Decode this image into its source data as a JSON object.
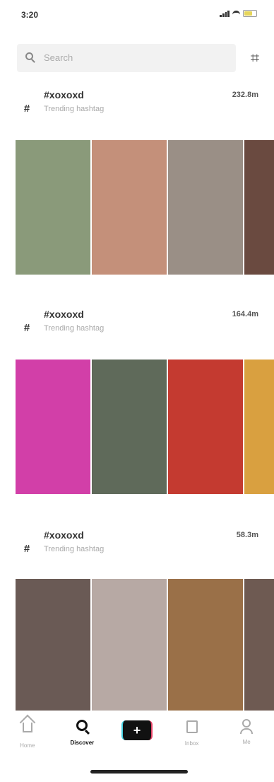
{
  "status": {
    "time": "3:20"
  },
  "search": {
    "placeholder": "Search",
    "scan_glyph": "⌗"
  },
  "sections": [
    {
      "title": "#xoxoxd",
      "subtitle": "Trending hashtag",
      "count": "232.8m",
      "thumb_colors": [
        "#8a9a7a",
        "#c4907a",
        "#9a8f86",
        "#6a4a40"
      ]
    },
    {
      "title": "#xoxoxd",
      "subtitle": "Trending hashtag",
      "count": "164.4m",
      "thumb_colors": [
        "#d23fa8",
        "#5f6a5a",
        "#c43a30",
        "#d9a040"
      ]
    },
    {
      "title": "#xoxoxd",
      "subtitle": "Trending hashtag",
      "count": "58.3m",
      "thumb_colors": [
        "#6a5a55",
        "#b7a9a4",
        "#9a7048",
        "#6e5a52"
      ]
    }
  ],
  "tabbar": {
    "home_label": "Home",
    "discover_label": "Discover",
    "create_label": "+",
    "inbox_label": "Inbox",
    "me_label": "Me"
  }
}
